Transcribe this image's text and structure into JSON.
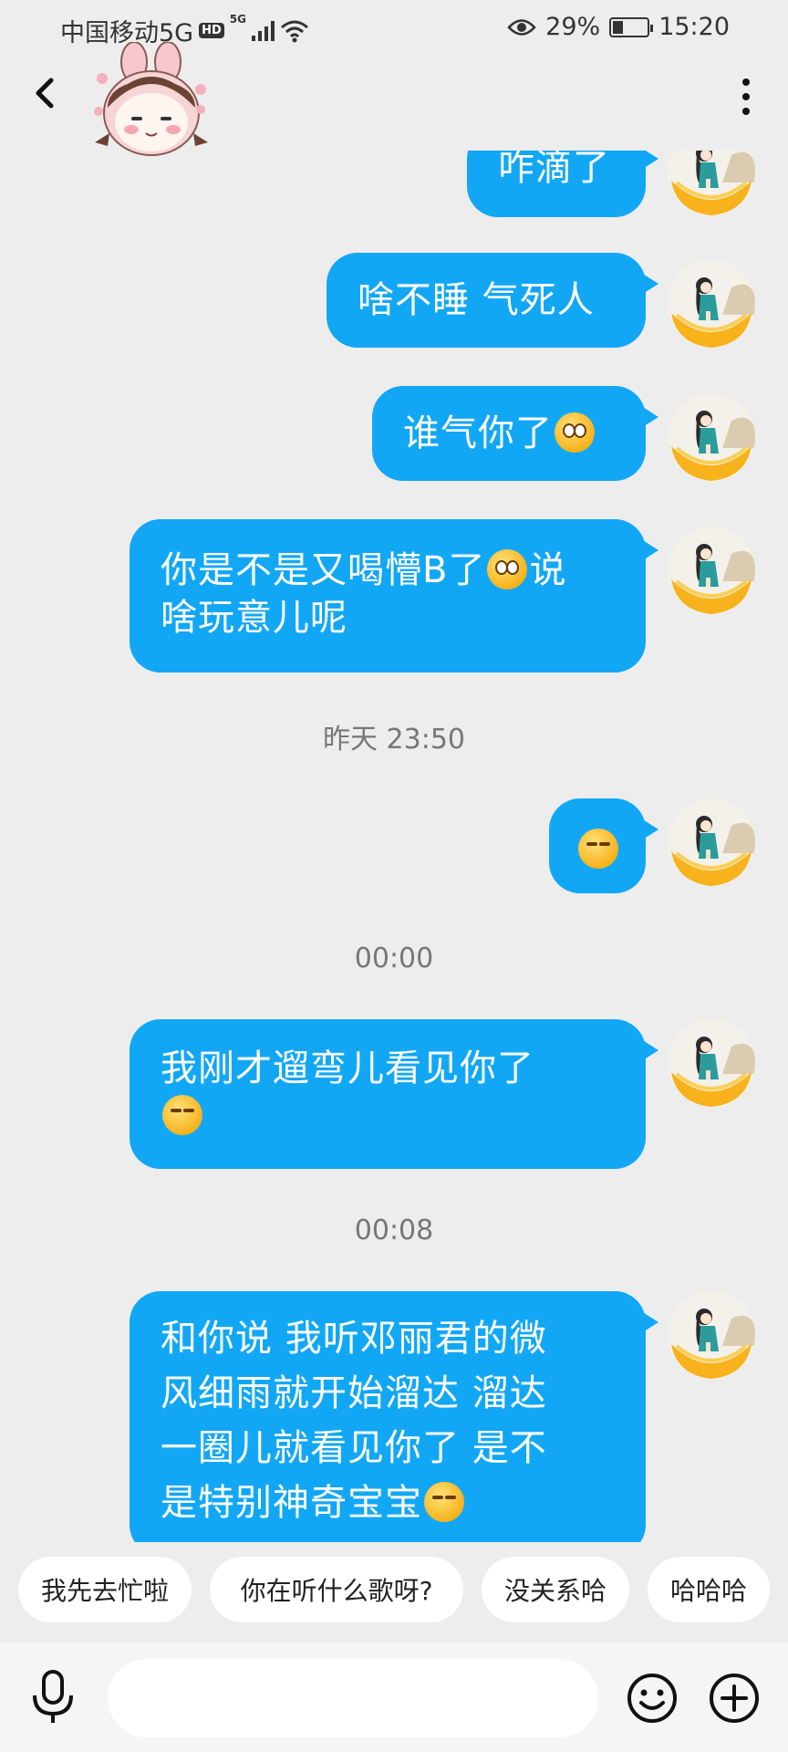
{
  "status_bar": {
    "carrier": "中国移动5G",
    "hd_badge": "HD",
    "network": "5G",
    "battery": "29%",
    "battery_level": 0.29,
    "time": "15:20"
  },
  "header": {
    "back_icon": "chevron-left-icon",
    "avatar_icon": "bunny-avatar-icon",
    "more_icon": "more-vertical-icon"
  },
  "messages": [
    {
      "type": "sent",
      "text": "咋滴了"
    },
    {
      "type": "sent",
      "text": "啥不睡 气死人"
    },
    {
      "type": "sent",
      "text": "谁气你了",
      "emoji": "flushed-face-emoji"
    },
    {
      "type": "sent",
      "line1_a": "你是不是又喝懵B了",
      "line1_b": "说",
      "line2": "啥玩意儿呢",
      "emoji": "flushed-face-emoji"
    },
    {
      "type": "time",
      "text": "昨天 23:50"
    },
    {
      "type": "sent",
      "emoji": "hugging-face-emoji"
    },
    {
      "type": "time",
      "text": "00:00"
    },
    {
      "type": "sent",
      "text": "我刚才遛弯儿看见你了",
      "emoji": "hugging-face-emoji"
    },
    {
      "type": "time",
      "text": "00:08"
    },
    {
      "type": "sent",
      "line1": "和你说 我听邓丽君的微",
      "line2": "风细雨就开始溜达 溜达",
      "line3": "一圈儿就看见你了 是不",
      "line4": "是特别神奇宝宝",
      "emoji": "hugging-face-emoji"
    }
  ],
  "quick_replies": [
    "我先去忙啦",
    "你在听什么歌呀?",
    "没关系哈",
    "哈哈哈"
  ],
  "input_bar": {
    "mic_icon": "microphone-icon",
    "input_value": "",
    "emoji_icon": "smiley-icon",
    "plus_icon": "plus-circle-icon"
  },
  "colors": {
    "bubble": "#12a7f5",
    "background": "#ededed",
    "bubble_text": "#ffffff"
  }
}
